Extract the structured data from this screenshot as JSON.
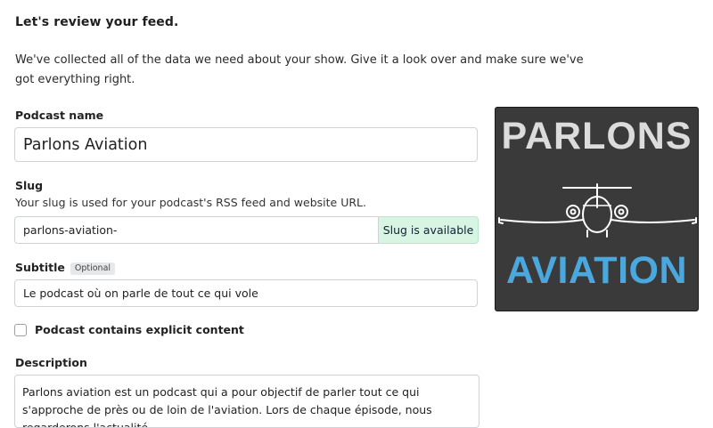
{
  "page": {
    "heading": "Let's review your feed.",
    "intro": "We've collected all of the data we need about your show. Give it a look over and make sure we've got everything right."
  },
  "podcast_name": {
    "label": "Podcast name",
    "value": "Parlons Aviation"
  },
  "slug": {
    "label": "Slug",
    "hint": "Your slug is used for your podcast's RSS feed and website URL.",
    "value": "parlons-aviation-",
    "status": "Slug is available"
  },
  "subtitle": {
    "label": "Subtitle",
    "badge": "Optional",
    "value": "Le podcast où on parle de tout ce qui vole"
  },
  "explicit": {
    "label": "Podcast contains explicit content",
    "checked": false
  },
  "description": {
    "label": "Description",
    "value": "Parlons aviation est un podcast qui a pour objectif de parler tout ce qui s'approche de près ou de loin de l'aviation. Lors de chaque épisode, nous regarderons l'actualité"
  },
  "cover_art": {
    "line1": "PARLONS",
    "line2": "AVIATION",
    "colors": {
      "background": "#3a3a3a",
      "line1": "#dcdcdc",
      "line2": "#4aa8df"
    },
    "icon": "jet-plane-front-icon"
  },
  "colors": {
    "available_bg": "#d8f5e4",
    "input_border": "#cfd3d7",
    "badge_bg": "#e6e8ea"
  }
}
